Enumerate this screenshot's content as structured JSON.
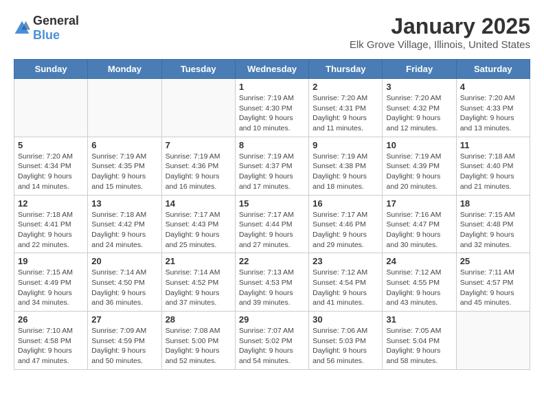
{
  "header": {
    "logo_general": "General",
    "logo_blue": "Blue",
    "title": "January 2025",
    "subtitle": "Elk Grove Village, Illinois, United States"
  },
  "days_of_week": [
    "Sunday",
    "Monday",
    "Tuesday",
    "Wednesday",
    "Thursday",
    "Friday",
    "Saturday"
  ],
  "weeks": [
    [
      {
        "day": "",
        "info": ""
      },
      {
        "day": "",
        "info": ""
      },
      {
        "day": "",
        "info": ""
      },
      {
        "day": "1",
        "info": "Sunrise: 7:19 AM\nSunset: 4:30 PM\nDaylight: 9 hours\nand 10 minutes."
      },
      {
        "day": "2",
        "info": "Sunrise: 7:20 AM\nSunset: 4:31 PM\nDaylight: 9 hours\nand 11 minutes."
      },
      {
        "day": "3",
        "info": "Sunrise: 7:20 AM\nSunset: 4:32 PM\nDaylight: 9 hours\nand 12 minutes."
      },
      {
        "day": "4",
        "info": "Sunrise: 7:20 AM\nSunset: 4:33 PM\nDaylight: 9 hours\nand 13 minutes."
      }
    ],
    [
      {
        "day": "5",
        "info": "Sunrise: 7:20 AM\nSunset: 4:34 PM\nDaylight: 9 hours\nand 14 minutes."
      },
      {
        "day": "6",
        "info": "Sunrise: 7:19 AM\nSunset: 4:35 PM\nDaylight: 9 hours\nand 15 minutes."
      },
      {
        "day": "7",
        "info": "Sunrise: 7:19 AM\nSunset: 4:36 PM\nDaylight: 9 hours\nand 16 minutes."
      },
      {
        "day": "8",
        "info": "Sunrise: 7:19 AM\nSunset: 4:37 PM\nDaylight: 9 hours\nand 17 minutes."
      },
      {
        "day": "9",
        "info": "Sunrise: 7:19 AM\nSunset: 4:38 PM\nDaylight: 9 hours\nand 18 minutes."
      },
      {
        "day": "10",
        "info": "Sunrise: 7:19 AM\nSunset: 4:39 PM\nDaylight: 9 hours\nand 20 minutes."
      },
      {
        "day": "11",
        "info": "Sunrise: 7:18 AM\nSunset: 4:40 PM\nDaylight: 9 hours\nand 21 minutes."
      }
    ],
    [
      {
        "day": "12",
        "info": "Sunrise: 7:18 AM\nSunset: 4:41 PM\nDaylight: 9 hours\nand 22 minutes."
      },
      {
        "day": "13",
        "info": "Sunrise: 7:18 AM\nSunset: 4:42 PM\nDaylight: 9 hours\nand 24 minutes."
      },
      {
        "day": "14",
        "info": "Sunrise: 7:17 AM\nSunset: 4:43 PM\nDaylight: 9 hours\nand 25 minutes."
      },
      {
        "day": "15",
        "info": "Sunrise: 7:17 AM\nSunset: 4:44 PM\nDaylight: 9 hours\nand 27 minutes."
      },
      {
        "day": "16",
        "info": "Sunrise: 7:17 AM\nSunset: 4:46 PM\nDaylight: 9 hours\nand 29 minutes."
      },
      {
        "day": "17",
        "info": "Sunrise: 7:16 AM\nSunset: 4:47 PM\nDaylight: 9 hours\nand 30 minutes."
      },
      {
        "day": "18",
        "info": "Sunrise: 7:15 AM\nSunset: 4:48 PM\nDaylight: 9 hours\nand 32 minutes."
      }
    ],
    [
      {
        "day": "19",
        "info": "Sunrise: 7:15 AM\nSunset: 4:49 PM\nDaylight: 9 hours\nand 34 minutes."
      },
      {
        "day": "20",
        "info": "Sunrise: 7:14 AM\nSunset: 4:50 PM\nDaylight: 9 hours\nand 36 minutes."
      },
      {
        "day": "21",
        "info": "Sunrise: 7:14 AM\nSunset: 4:52 PM\nDaylight: 9 hours\nand 37 minutes."
      },
      {
        "day": "22",
        "info": "Sunrise: 7:13 AM\nSunset: 4:53 PM\nDaylight: 9 hours\nand 39 minutes."
      },
      {
        "day": "23",
        "info": "Sunrise: 7:12 AM\nSunset: 4:54 PM\nDaylight: 9 hours\nand 41 minutes."
      },
      {
        "day": "24",
        "info": "Sunrise: 7:12 AM\nSunset: 4:55 PM\nDaylight: 9 hours\nand 43 minutes."
      },
      {
        "day": "25",
        "info": "Sunrise: 7:11 AM\nSunset: 4:57 PM\nDaylight: 9 hours\nand 45 minutes."
      }
    ],
    [
      {
        "day": "26",
        "info": "Sunrise: 7:10 AM\nSunset: 4:58 PM\nDaylight: 9 hours\nand 47 minutes."
      },
      {
        "day": "27",
        "info": "Sunrise: 7:09 AM\nSunset: 4:59 PM\nDaylight: 9 hours\nand 50 minutes."
      },
      {
        "day": "28",
        "info": "Sunrise: 7:08 AM\nSunset: 5:00 PM\nDaylight: 9 hours\nand 52 minutes."
      },
      {
        "day": "29",
        "info": "Sunrise: 7:07 AM\nSunset: 5:02 PM\nDaylight: 9 hours\nand 54 minutes."
      },
      {
        "day": "30",
        "info": "Sunrise: 7:06 AM\nSunset: 5:03 PM\nDaylight: 9 hours\nand 56 minutes."
      },
      {
        "day": "31",
        "info": "Sunrise: 7:05 AM\nSunset: 5:04 PM\nDaylight: 9 hours\nand 58 minutes."
      },
      {
        "day": "",
        "info": ""
      }
    ]
  ]
}
